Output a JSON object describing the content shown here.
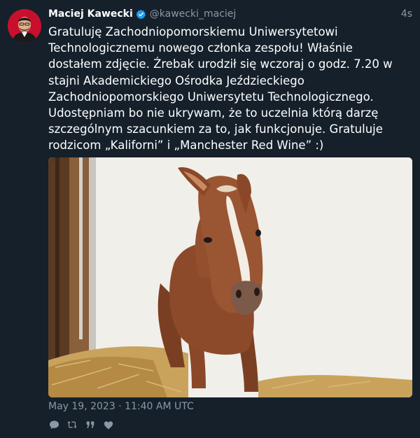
{
  "tweet": {
    "display_name": "Maciej Kawecki",
    "handle": "@kawecki_maciej",
    "time_ago": "4s",
    "verified": true,
    "text": "Gratuluję Zachodniopomorskiemu Uniwersytetowi Technologicznemu nowego członka zespołu! Właśnie dostałem zdjęcie. Źrebak urodził się wczoraj o godz. 7.20 w stajni Akademickiego Ośrodka Jeździeckiego Zachodniopomorskiego Uniwersytetu Technologicznego. Udostępniam bo nie ukrywam, że to uczelnia którą darzę szczególnym szacunkiem za to, jak funkcjonuje. Gratuluje rodzicom „Kaliforni” i „Manchester Red Wine” :)",
    "timestamp": "May 19, 2023 · 11:40 AM UTC"
  },
  "actions": {
    "reply_icon": "reply-icon",
    "retweet_icon": "retweet-icon",
    "quote_icon": "quote-icon",
    "like_icon": "like-icon"
  },
  "colors": {
    "background": "#15202b",
    "muted_text": "#8b98a5",
    "verified_blue": "#1d9bf0",
    "avatar_red": "#c8102e"
  }
}
